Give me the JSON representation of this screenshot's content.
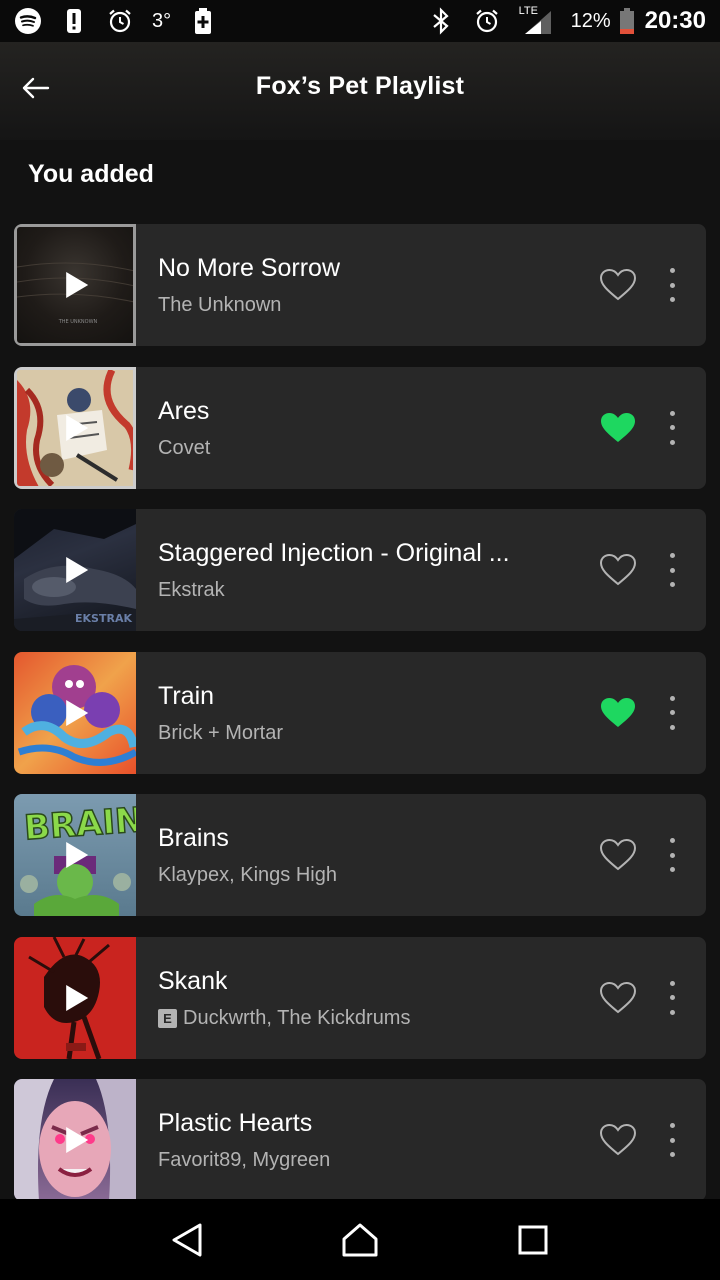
{
  "status_bar": {
    "left_icons": [
      "spotify-icon",
      "alert-icon",
      "alarm-icon",
      "temperature-icon",
      "battery-saver-icon"
    ],
    "temperature": "3°",
    "network": "LTE",
    "battery": "12%",
    "time": "20:30"
  },
  "header": {
    "title": "Fox’s Pet Playlist"
  },
  "section": {
    "title": "You added"
  },
  "tracks": [
    {
      "title": "No More Sorrow",
      "artist": "The Unknown",
      "liked": false,
      "explicit": false
    },
    {
      "title": "Ares",
      "artist": "Covet",
      "liked": true,
      "explicit": false
    },
    {
      "title": "Staggered Injection - Original ...",
      "artist": "Ekstrak",
      "liked": false,
      "explicit": false
    },
    {
      "title": "Train",
      "artist": "Brick + Mortar",
      "liked": true,
      "explicit": false
    },
    {
      "title": "Brains",
      "artist": "Klaypex, Kings High",
      "liked": false,
      "explicit": false
    },
    {
      "title": "Skank",
      "artist": "Duckwrth, The Kickdrums",
      "liked": false,
      "explicit": true,
      "explicit_label": "E"
    },
    {
      "title": "Plastic Hearts",
      "artist": "Favorit89, Mygreen",
      "liked": false,
      "explicit": false
    }
  ],
  "colors": {
    "accent": "#1ed760",
    "background": "#121212",
    "row": "#282828",
    "secondary_text": "#b3b3b3"
  },
  "nav": {
    "buttons": [
      "back-nav-icon",
      "home-nav-icon",
      "recents-nav-icon"
    ]
  }
}
